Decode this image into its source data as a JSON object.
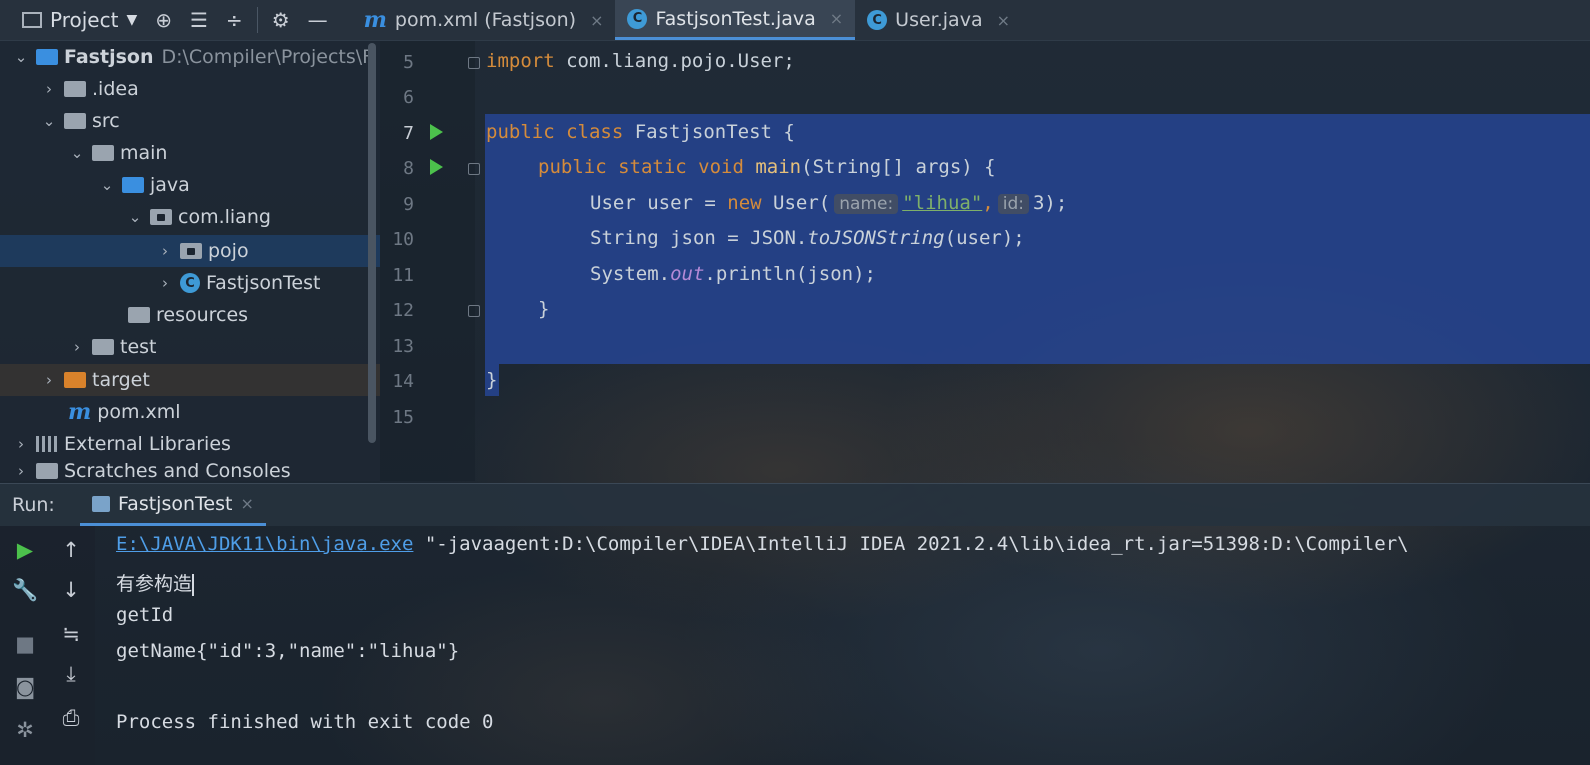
{
  "header": {
    "project_label": "Project",
    "tabs": [
      {
        "label": "pom.xml (Fastjson)",
        "icon": "maven-icon",
        "icon_glyph": "m"
      },
      {
        "label": "FastjsonTest.java",
        "icon": "java-class-icon",
        "icon_glyph": "C",
        "active": true
      },
      {
        "label": "User.java",
        "icon": "java-class-icon",
        "icon_glyph": "C"
      }
    ],
    "close_glyph": "×"
  },
  "tree": {
    "items": [
      {
        "label": "Fastjson",
        "path": "D:\\Compiler\\Projects\\F"
      },
      {
        "label": ".idea"
      },
      {
        "label": "src"
      },
      {
        "label": "main"
      },
      {
        "label": "java"
      },
      {
        "label": "com.liang"
      },
      {
        "label": "pojo"
      },
      {
        "label": "FastjsonTest"
      },
      {
        "label": "resources"
      },
      {
        "label": "test"
      },
      {
        "label": "target"
      },
      {
        "label": "pom.xml"
      },
      {
        "label": "External Libraries"
      },
      {
        "label": "Scratches and Consoles"
      }
    ]
  },
  "editor": {
    "line_numbers": [
      "5",
      "6",
      "7",
      "8",
      "9",
      "10",
      "11",
      "12",
      "13",
      "14",
      "15"
    ],
    "code": {
      "l5_kw": "import",
      "l5_rest": " com.liang.pojo.User;",
      "l7_kw": "public class",
      "l7_rest": " FastjsonTest {",
      "l8_kw": "public static void",
      "l8_fn": "main",
      "l8_rest": "(String[] args) {",
      "l9_a": "User user = ",
      "l9_kw": "new",
      "l9_b": " User(",
      "l9_hint_name": "name:",
      "l9_str": "\"lihua\"",
      "l9_comma": ",",
      "l9_hint_id": "id:",
      "l9_end": "3);",
      "l10_a": "String json = JSON.",
      "l10_it": "toJSONString",
      "l10_b": "(user);",
      "l11_a": "System.",
      "l11_fld": "out",
      "l11_b": ".println(json);",
      "l12": "}",
      "l14": "}"
    }
  },
  "run": {
    "label": "Run:",
    "tab_label": "FastjsonTest",
    "output": {
      "exe_link": "E:\\JAVA\\JDK11\\bin\\java.exe",
      "exe_args": " \"-javaagent:D:\\Compiler\\IDEA\\IntelliJ IDEA 2021.2.4\\lib\\idea_rt.jar=51398:D:\\Compiler\\",
      "line2": "有参构造",
      "line3": "getId",
      "line4": "getName{\"id\":3,\"name\":\"lihua\"}",
      "line6": "Process finished with exit code 0"
    }
  },
  "colors": {
    "accent": "#4b8fd6",
    "keyword": "#d58b3b",
    "selection": "#26468f",
    "run_green": "#4cc14c"
  }
}
